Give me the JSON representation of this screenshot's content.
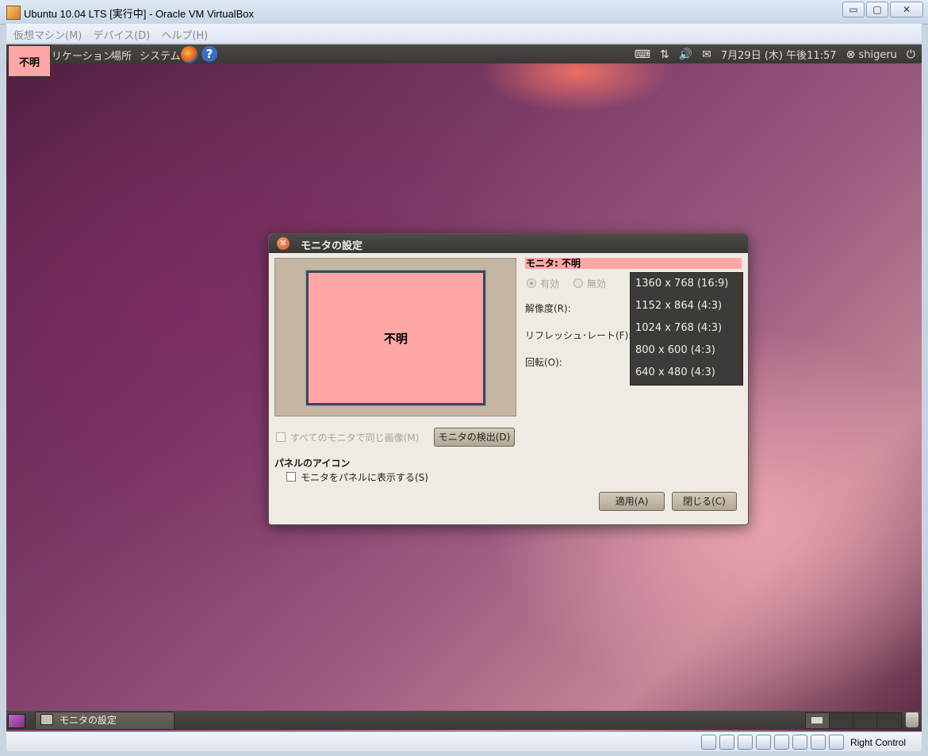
{
  "window": {
    "title": "Ubuntu 10.04 LTS [実行中] - Oracle VM VirtualBox",
    "controls": {
      "minimize": "▭",
      "maximize": "▢",
      "close": "✕"
    }
  },
  "vm_menu": [
    "仮想マシン(M)",
    "デバイス(D)",
    "ヘルプ(H)"
  ],
  "top_panel": {
    "badge": "不明",
    "menus": [
      "リケーション",
      "場所",
      "システム"
    ],
    "help_glyph": "?",
    "clock": "7月29日 (木) 午後11:57",
    "user": "shigeru",
    "tray_icons": [
      "keyboard-icon",
      "network-icon",
      "volume-icon",
      "mail-icon",
      "user-switch-icon",
      "power-icon"
    ]
  },
  "dialog": {
    "title": "モニタの設定",
    "close_glyph": "✕",
    "preview_monitor": "不明",
    "monitor_label": "モニタ: 不明",
    "radio_on": "有効",
    "radio_off": "無効",
    "resolution_label": "解像度(R):",
    "refresh_label": "リフレッシュ･レート(F):",
    "rotation_label": "回転(O):",
    "resolution_options": [
      "1360 x 768 (16:9)",
      "1152 x 864 (4:3)",
      "1024 x 768 (4:3)",
      "800 x 600 (4:3)",
      "640 x 480 (4:3)"
    ],
    "same_image_label": "すべてのモニタで同じ画像(M)",
    "detect_button": "モニタの検出(D)",
    "panel_icon_heading": "パネルのアイコン",
    "show_in_panel_label": "モニタをパネルに表示する(S)",
    "apply_button": "適用(A)",
    "close_button": "閉じる(C)"
  },
  "bottom_panel": {
    "task_label": "モニタの設定"
  },
  "statusbar": {
    "host_key": "Right Control"
  },
  "colors": {
    "badge_pink": "#ffa7a6",
    "panel_dark": "#3a3835",
    "dialog_bg": "#efebe4"
  }
}
